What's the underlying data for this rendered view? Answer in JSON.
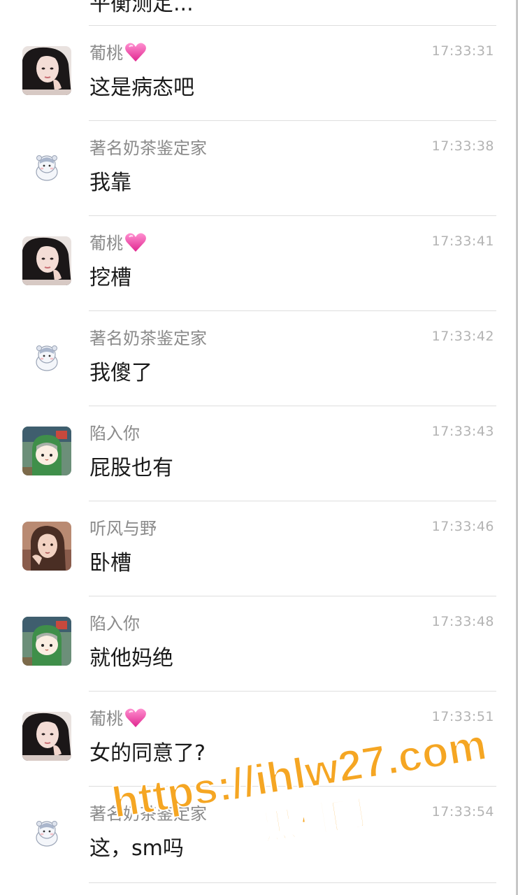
{
  "partial_top_text": "平衡测定...",
  "messages": [
    {
      "name": "葡桃",
      "heart": true,
      "time": "17:33:31",
      "text": "这是病态吧",
      "avatar": "girl-dark-hair-avatar"
    },
    {
      "name": "著名奶茶鉴定家",
      "heart": false,
      "time": "17:33:38",
      "text": "我靠",
      "avatar": "hamster-avatar"
    },
    {
      "name": "葡桃",
      "heart": true,
      "time": "17:33:41",
      "text": "挖槽",
      "avatar": "girl-dark-hair-avatar"
    },
    {
      "name": "著名奶茶鉴定家",
      "heart": false,
      "time": "17:33:42",
      "text": "我傻了",
      "avatar": "hamster-avatar"
    },
    {
      "name": "陷入你",
      "heart": false,
      "time": "17:33:43",
      "text": "屁股也有",
      "avatar": "anime-green-hood-avatar"
    },
    {
      "name": "听风与野",
      "heart": false,
      "time": "17:33:46",
      "text": "卧槽",
      "avatar": "girl-brown-hair-avatar"
    },
    {
      "name": "陷入你",
      "heart": false,
      "time": "17:33:48",
      "text": "就他妈绝",
      "avatar": "anime-green-hood-avatar"
    },
    {
      "name": "葡桃",
      "heart": true,
      "time": "17:33:51",
      "text": "女的同意了?",
      "avatar": "girl-dark-hair-avatar"
    },
    {
      "name": "著名奶茶鉴定家",
      "heart": false,
      "time": "17:33:54",
      "text": "这，sm吗",
      "avatar": "hamster-avatar"
    }
  ],
  "watermark": {
    "url": "https://ihlw27.com",
    "site": "黑料网",
    "color": "#f5a623"
  }
}
